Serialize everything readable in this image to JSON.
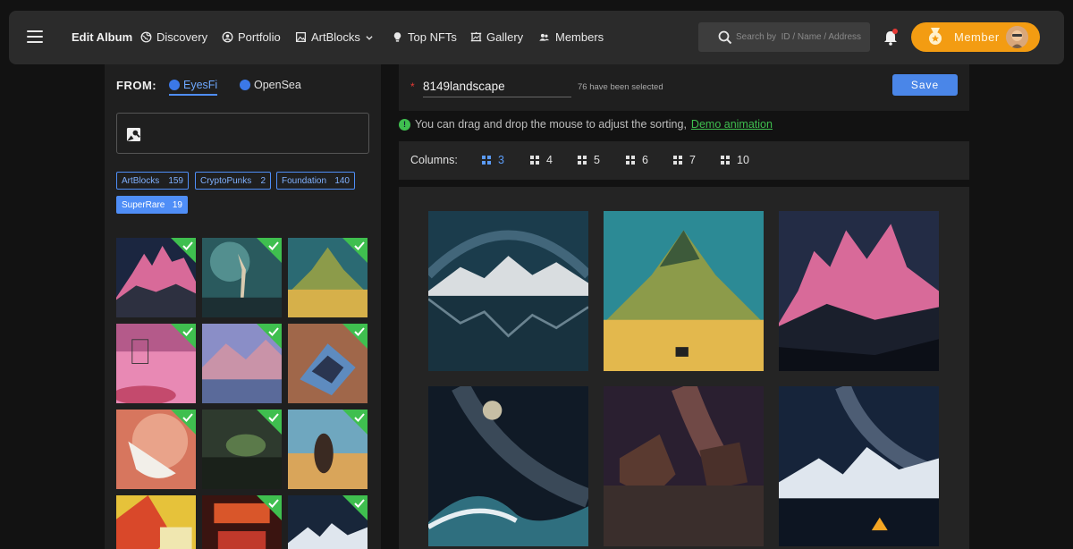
{
  "nav": {
    "title": "Edit Album",
    "items": [
      {
        "label": "Discovery",
        "icon": "globe-icon"
      },
      {
        "label": "Portfolio",
        "icon": "user-circle-icon"
      },
      {
        "label": "ArtBlocks",
        "icon": "image-icon"
      },
      {
        "label": "Top NFTs",
        "icon": "bulb-icon"
      },
      {
        "label": "Gallery",
        "icon": "frame-icon"
      },
      {
        "label": "Members",
        "icon": "users-icon"
      }
    ],
    "search_placeholder": "Search by  ID / Name / Address",
    "member_label": "Member"
  },
  "left": {
    "from_label": "FROM:",
    "sources": [
      "EyesFi",
      "OpenSea"
    ],
    "chips": [
      {
        "label": "ArtBlocks",
        "count": "159"
      },
      {
        "label": "CryptoPunks",
        "count": "2"
      },
      {
        "label": "Foundation",
        "count": "140"
      },
      {
        "label": "SuperRare",
        "count": "19"
      }
    ]
  },
  "editor": {
    "album_name": "8149landscape",
    "selected_text": "76 have been selected",
    "save_label": "Save",
    "hint_text": "You can drag and drop the mouse to adjust the sorting,",
    "hint_link": " Demo animation",
    "columns_label": "Columns:",
    "column_options": [
      "3",
      "4",
      "5",
      "6",
      "7",
      "10"
    ],
    "active_columns": "3"
  },
  "colors": {
    "accent": "#4a86e8",
    "member": "#f39c12",
    "check": "#3fbf4f"
  }
}
